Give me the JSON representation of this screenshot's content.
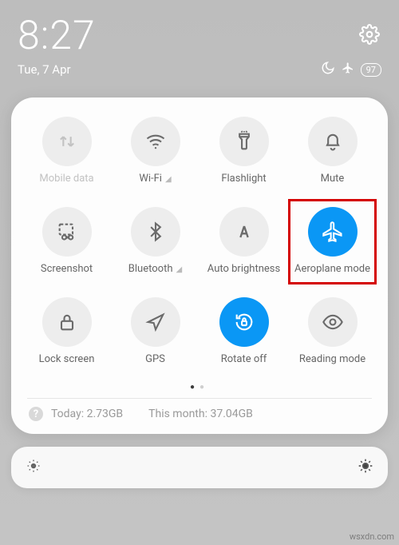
{
  "status_bar": {
    "time": "8:27",
    "date": "Tue, 7 Apr",
    "battery": "97"
  },
  "tiles": {
    "mobile_data": "Mobile data",
    "wifi": "Wi-Fi",
    "flashlight": "Flashlight",
    "mute": "Mute",
    "screenshot": "Screenshot",
    "bluetooth": "Bluetooth",
    "auto_brightness": "Auto brightness",
    "aeroplane_mode": "Aeroplane mode",
    "lock_screen": "Lock screen",
    "gps": "GPS",
    "rotate_off": "Rotate off",
    "reading_mode": "Reading mode"
  },
  "usage": {
    "today_label": "Today:",
    "today_value": "2.73GB",
    "month_label": "This month:",
    "month_value": "37.04GB"
  },
  "watermark": "wsxdn.com"
}
